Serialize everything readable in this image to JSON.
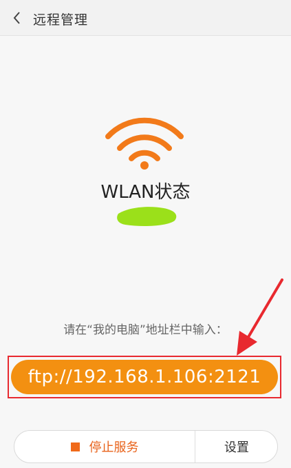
{
  "header": {
    "title": "远程管理",
    "back_icon": "chevron-left-icon"
  },
  "wlan": {
    "status_label": "WLAN状态",
    "icon": "wifi-icon",
    "icon_color": "#f27a1a",
    "ssid_mask_color": "#9be01a"
  },
  "instruction": {
    "text": "请在“我的电脑”地址栏中输入："
  },
  "ftp": {
    "address": "ftp://192.168.1.106:2121",
    "pill_color": "#f39011",
    "highlight_color": "#e8292f"
  },
  "annotation": {
    "arrow_color": "#e8292f"
  },
  "actions": {
    "stop_label": "停止服务",
    "stop_icon": "stop-icon",
    "stop_color": "#e8621a",
    "settings_label": "设置"
  }
}
